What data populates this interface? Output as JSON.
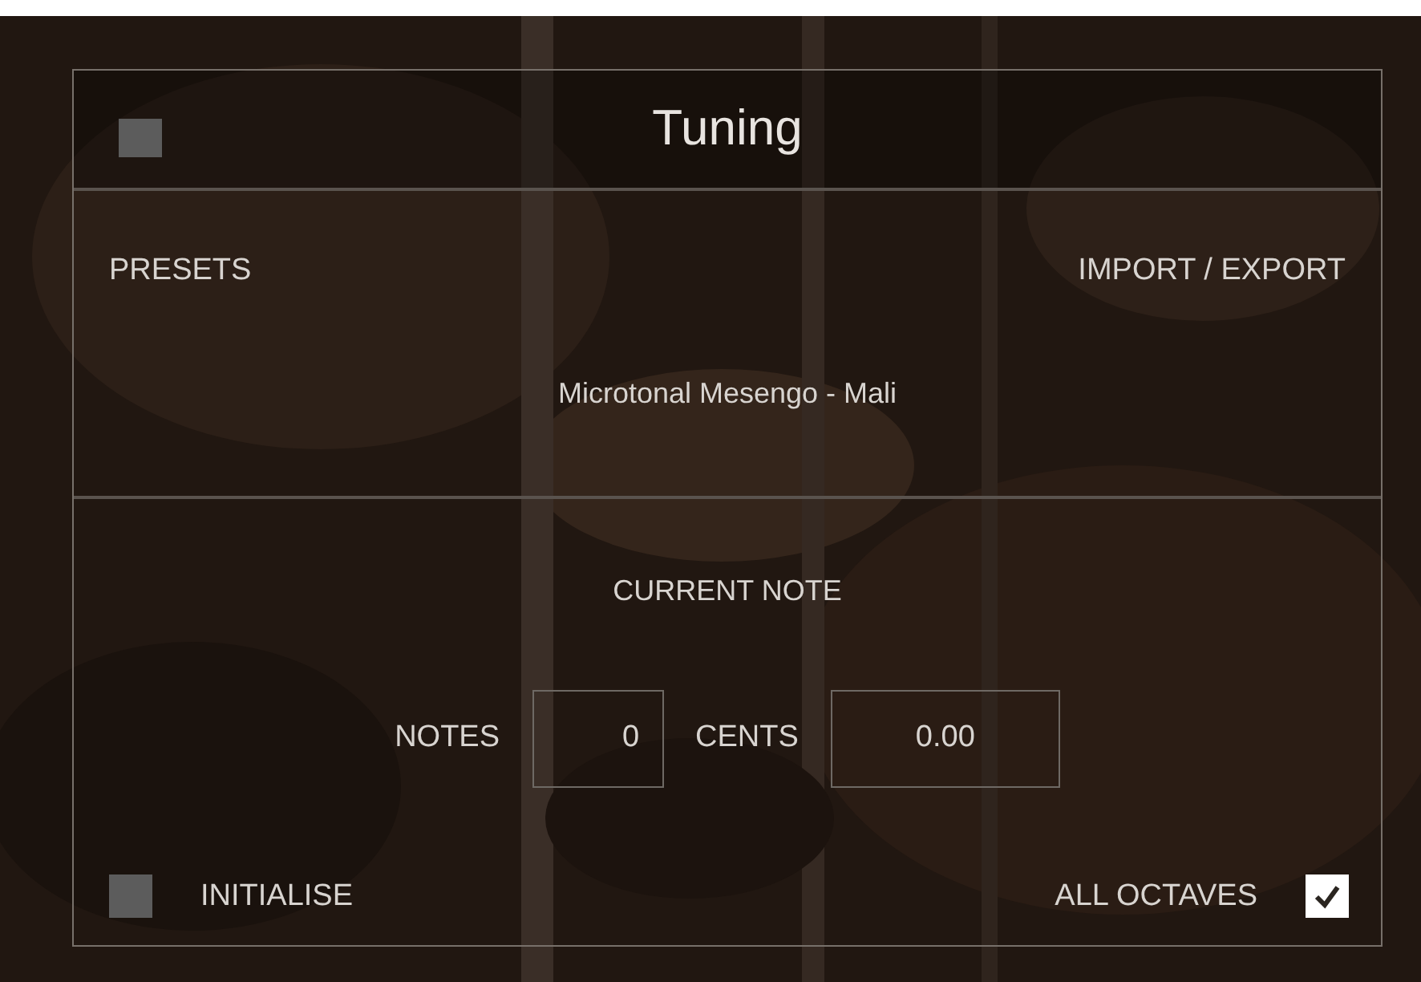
{
  "header": {
    "title": "Tuning",
    "enabled": false
  },
  "presets": {
    "label": "PRESETS",
    "import_export": "IMPORT / EXPORT",
    "current_preset": "Microtonal Mesengo - Mali"
  },
  "current_note": {
    "title": "CURRENT NOTE",
    "fields": [
      {
        "label": "NOTES",
        "value": "0"
      },
      {
        "label": "CENTS",
        "value": "0.00"
      }
    ]
  },
  "options": [
    {
      "label": "INITIALISE",
      "checked": false
    },
    {
      "label": "ALL OCTAVES",
      "checked": true
    }
  ]
}
